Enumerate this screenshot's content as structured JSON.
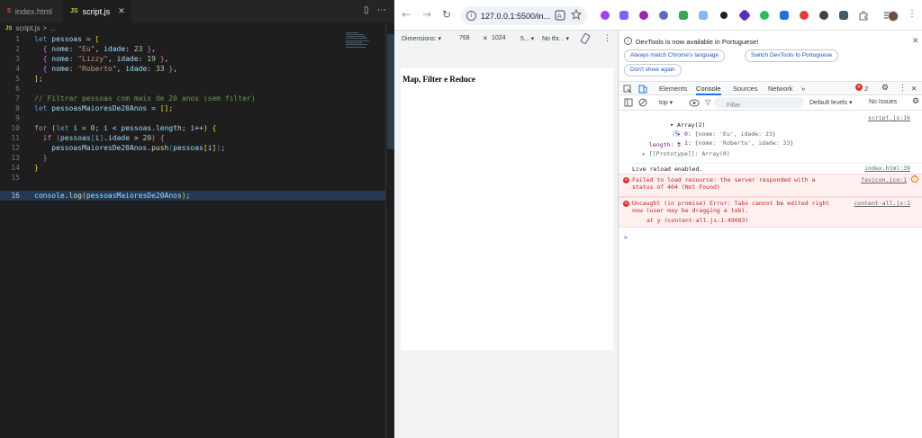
{
  "vscode": {
    "tabs": [
      {
        "icon": "5",
        "label": "index.html"
      },
      {
        "icon": "JS",
        "label": "script.js",
        "close": "✕"
      }
    ],
    "toolbar_icons": [
      "▯",
      "⋯"
    ],
    "breadcrumb": {
      "icon": "JS",
      "file": "script.js",
      "sep": ">",
      "rest": "..."
    },
    "line_numbers": [
      "1",
      "2",
      "3",
      "4",
      "5",
      "6",
      "7",
      "8",
      "9",
      "10",
      "11",
      "12",
      "13",
      "14",
      "15",
      "16"
    ]
  },
  "browser": {
    "nav": {
      "back": "←",
      "forward": "→",
      "reload": "↻"
    },
    "url": "127.0.0.1:5500/in...",
    "device_bar": {
      "dimensions": "Dimensions: ▾",
      "width": "768",
      "times": "✕",
      "height": "1024",
      "zoom": "5... ▾",
      "throttle": "No thr... ▾"
    },
    "page": {
      "heading": "Map, Filter e Reduce"
    }
  },
  "devtools": {
    "notice": {
      "text": "DevTools is now available in Portuguese!",
      "buttons": [
        "Always match Chrome's language",
        "Switch DevTools to Portuguese",
        "Don't show again"
      ]
    },
    "tabs": [
      "Elements",
      "Console",
      "Sources",
      "Network",
      "»"
    ],
    "active_tab": "Console",
    "error_count": "2",
    "filterbar": {
      "context": "top ▾",
      "filter_placeholder": "Filter",
      "levels": "Default levels ▾",
      "issues": "No Issues"
    },
    "console": {
      "array_header": "▾ Array(2)",
      "array_src": "script.js:16",
      "items": [
        {
          "prefix": "▸ 0: ",
          "content": "{nome: 'Eu', idade: 23}"
        },
        {
          "prefix": "▸ 1: ",
          "content": "{nome: 'Roberto', idade: 33}"
        }
      ],
      "length_line": "length: 2",
      "proto_line": "▸ [[Prototype]]: Array(0)",
      "reload": "Live reload enabled.",
      "reload_src": "index.html:39",
      "error1": {
        "text": "Failed to load resource: the server responded with a\nstatus of 404 (Not Found)",
        "src": "favicon.ico:1"
      },
      "error2": {
        "text": "Uncaught (in promise) Error: Tabs cannot be edited right\nnow (user may be dragging a tab).",
        "stack": "at y (content-all.js:1:49083)",
        "src": "content-all.js:1"
      },
      "prompt": ">"
    }
  }
}
